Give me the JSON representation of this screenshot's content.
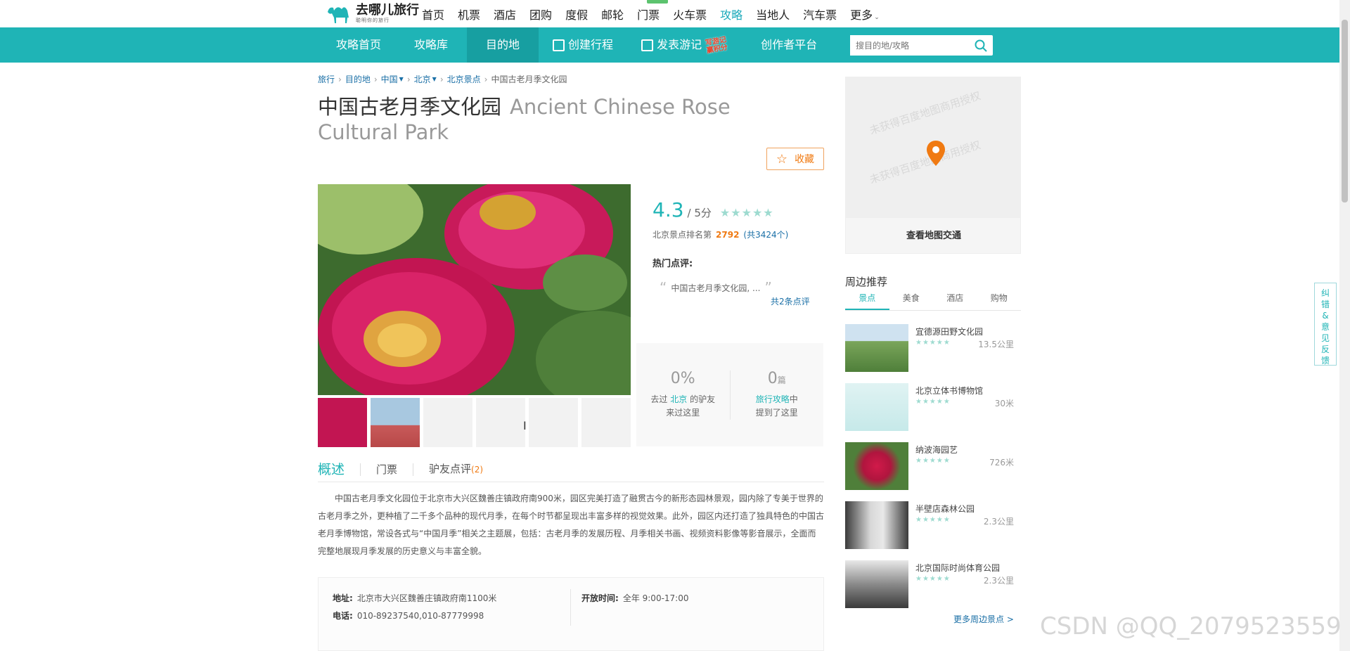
{
  "logo": {
    "main": "去哪儿旅行",
    "sub": "聪明你的旅行"
  },
  "topnav": [
    "首页",
    "机票",
    "酒店",
    "团购",
    "度假",
    "邮轮",
    "门票",
    "火车票",
    "攻略",
    "当地人",
    "汽车票",
    "更多"
  ],
  "topnav_active": "攻略",
  "subnav": {
    "home": "攻略首页",
    "library": "攻略库",
    "destination": "目的地",
    "create": "创建行程",
    "publish": "发表游记",
    "publish_badge": "写游记赢积分",
    "creator": "创作者平台"
  },
  "search": {
    "placeholder": "搜目的地/攻略"
  },
  "breadcrumb": [
    "旅行",
    "目的地",
    "中国",
    "北京",
    "北京景点",
    "中国古老月季文化园"
  ],
  "title": {
    "cn": "中国古老月季文化园",
    "en": "Ancient Chinese Rose Cultural Park"
  },
  "fav_label": "收藏",
  "rating": {
    "score": "4.3",
    "of": "/ 5分",
    "stars": "★★★★★",
    "rank_prefix": "北京景点排名第",
    "rank": "2792",
    "rank_total": "(共3424个)",
    "hot_label": "热门点评:",
    "quote": "中国古老月季文化园, ...",
    "more_comments": "共2条点评"
  },
  "stats": {
    "visited_pct": "0%",
    "visited_pre": "去过",
    "visited_city": "北京",
    "visited_post": "的驴友",
    "visited_line2": "来过这里",
    "mentioned_num": "0",
    "mentioned_unit": "篇",
    "mentioned_link": "旅行攻略",
    "mentioned_mid": "中",
    "mentioned_line2": "提到了这里"
  },
  "tabs": {
    "overview": "概述",
    "tickets": "门票",
    "reviews": "驴友点评",
    "reviews_count": "(2)"
  },
  "description": "中国古老月季文化园位于北京市大兴区魏善庄镇政府南900米，园区完美打造了融贯古今的新形态园林景观，园内除了专美于世界的古老月季之外，更种植了二千多个品种的现代月季，在每个时节都呈现出丰富多样的视觉效果。此外，园区内还打造了独具特色的中国古老月季博物馆，常设各式与“中国月季”相关之主题展，包括：古老月季的发展历程、月季相关书画、视频资料影像等影音展示，全面而完整地展现月季发展的历史意义与丰富全貌。",
  "info": {
    "address_label": "地址:",
    "address": "北京市大兴区魏善庄镇政府南1100米",
    "phone_label": "电话:",
    "phone": "010-89237540,010-87779998",
    "hours_label": "开放时间:",
    "hours": "全年 9:00-17:00"
  },
  "map": {
    "watermark": "未获得百度地图商用授权",
    "button": "查看地图交通"
  },
  "nearby": {
    "title": "周边推荐",
    "tabs": [
      "景点",
      "美食",
      "酒店",
      "购物"
    ],
    "items": [
      {
        "name": "宜德源田野文化园",
        "dist": "13.5公里",
        "stars": "★★★★★"
      },
      {
        "name": "北京立体书博物馆",
        "dist": "30米",
        "stars": "★★★★★"
      },
      {
        "name": "纳波海园艺",
        "dist": "726米",
        "stars": "★★★★★"
      },
      {
        "name": "半壁店森林公园",
        "dist": "2.3公里",
        "stars": "★★★★★"
      },
      {
        "name": "北京国际时尚体育公园",
        "dist": "2.3公里",
        "stars": "★★★★★"
      }
    ],
    "more": "更多周边景点 >"
  },
  "feedback": "纠错&意见反馈",
  "watermark": "CSDN @QQ_2079523559",
  "colors": {
    "brand": "#1fb4b6",
    "accent": "#f07a12",
    "link": "#1a6fa6"
  }
}
